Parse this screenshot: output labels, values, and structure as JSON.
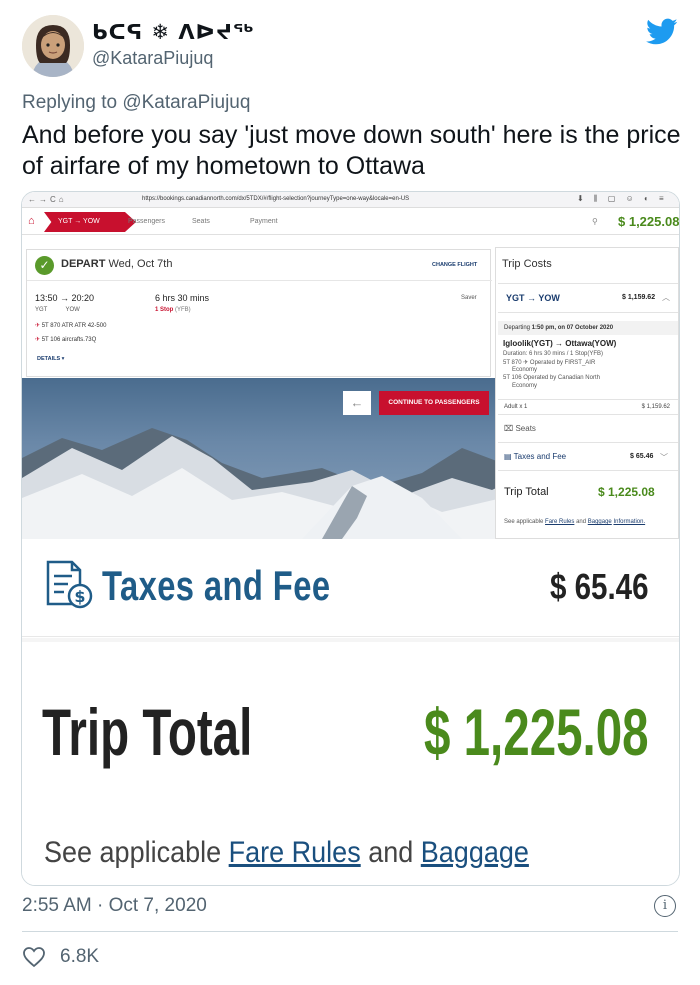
{
  "user": {
    "display_name": "ᑲᑕᕋ ❄ ᐱᐅᔪᖅ",
    "handle": "@KataraPiujuq"
  },
  "tweet": {
    "reply_prefix": "Replying to",
    "reply_to": "@KataraPiujuq",
    "text": "And before you say 'just move down south' here is the price of airfare of my hometown to Ottawa",
    "timestamp": "2:55 AM · Oct 7, 2020",
    "likes": "6.8K"
  },
  "browser": {
    "url": "https://bookings.canadiannorth.com/dx/5TDX/#/flight-selection?journeyType=one-way&locale=en-US",
    "steps": [
      "YGT → YOW",
      "Passengers",
      "Seats",
      "Payment"
    ],
    "header_total": "$ 1,225.08"
  },
  "depart_card": {
    "label": "DEPART",
    "date": "Wed, Oct 7th",
    "change_flight": "CHANGE FLIGHT",
    "times": "13:50 → 20:20",
    "from": "YGT",
    "to": "YOW",
    "duration": "6 hrs 30 mins",
    "stops": "1 Stop",
    "via": "(YFB)",
    "fare": "Saver",
    "segment1": "5T 870  ATR ATR 42-500",
    "segment2": "5T 106  aircrafts.73Q",
    "details": "DETAILS ▾",
    "back_button": "←",
    "continue_button": "CONTINUE TO PASSENGERS"
  },
  "trip_costs": {
    "title": "Trip Costs",
    "route": "YGT → YOW",
    "route_price": "$ 1,159.62",
    "departing_label": "Departing",
    "departing_value": "1:50 pm, on 07 October 2020",
    "airports": "Igloolik(YGT)  →  Ottawa(YOW)",
    "duration_line": "Duration: 6 hrs 30 mins / 1 Stop(YFB)",
    "seg1": "5T 870   ✈ Operated by FIRST_AIR",
    "seg1_cabin": "Economy",
    "seg2": "5T 106   Operated by Canadian North",
    "seg2_cabin": "Economy",
    "adult": "Adult x 1",
    "adult_price": "$ 1,159.62",
    "seats": "Seats",
    "taxes": "Taxes and Fee",
    "taxes_price": "$ 65.46",
    "total_label": "Trip Total",
    "total_value": "$ 1,225.08",
    "see_prefix": "See applicable",
    "fare_rules": "Fare Rules",
    "and": "and",
    "baggage": "Baggage",
    "information": "Information."
  },
  "zoom": {
    "taxes_label": "Taxes and Fee",
    "taxes_value": "$ 65.46",
    "total_label": "Trip Total",
    "total_value": "$ 1,225.08",
    "see_prefix": "See applicable",
    "fare_rules": "Fare Rules",
    "and": "and",
    "baggage": "Baggage"
  },
  "colors": {
    "twitter_blue": "#1d9bf0",
    "brand_red": "#c8102e",
    "total_green": "#4a8a1c"
  }
}
